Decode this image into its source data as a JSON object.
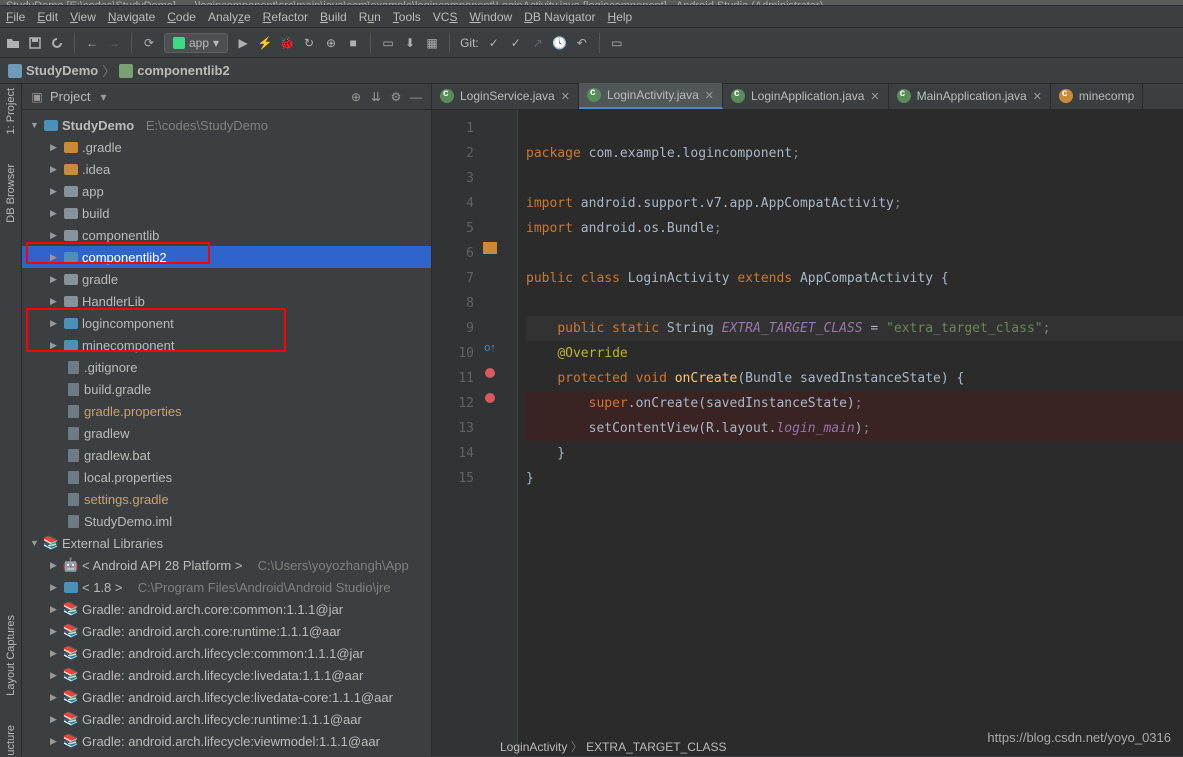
{
  "title": "StudyDemo [E:\\codes\\StudyDemo] - ...\\logincomponent\\src\\main\\java\\com\\example\\logincomponent\\LoginActivity.java [logincomponent] - Android Studio (Administrator)",
  "menu": [
    "File",
    "Edit",
    "View",
    "Navigate",
    "Code",
    "Analyze",
    "Refactor",
    "Build",
    "Run",
    "Tools",
    "VCS",
    "Window",
    "DB Navigator",
    "Help"
  ],
  "runConfig": "app",
  "gitLabel": "Git:",
  "breadcrumb": {
    "root": "StudyDemo",
    "item": "componentlib2"
  },
  "panel": {
    "title": "Project"
  },
  "leftStripe": [
    "1: Project",
    "DB Browser",
    "Layout Captures",
    "ucture"
  ],
  "tree": {
    "root": "StudyDemo",
    "rootPath": "E:\\codes\\StudyDemo",
    "items": [
      ".gradle",
      ".idea",
      "app",
      "build",
      "componentlib",
      "componentlib2",
      "gradle",
      "HandlerLib",
      "logincomponent",
      "minecomponent",
      ".gitignore",
      "build.gradle",
      "gradle.properties",
      "gradlew",
      "gradlew.bat",
      "local.properties",
      "settings.gradle",
      "StudyDemo.iml"
    ],
    "extlib": "External Libraries",
    "ext": {
      "androidSdk": "< Android API 28 Platform >",
      "androidSdkPath": "C:\\Users\\yoyozhangh\\App",
      "jdk": "< 1.8 >",
      "jdkPath": "C:\\Program Files\\Android\\Android Studio\\jre",
      "libs": [
        "Gradle: android.arch.core:common:1.1.1@jar",
        "Gradle: android.arch.core:runtime:1.1.1@aar",
        "Gradle: android.arch.lifecycle:common:1.1.1@jar",
        "Gradle: android.arch.lifecycle:livedata:1.1.1@aar",
        "Gradle: android.arch.lifecycle:livedata-core:1.1.1@aar",
        "Gradle: android.arch.lifecycle:runtime:1.1.1@aar",
        "Gradle: android.arch.lifecycle:viewmodel:1.1.1@aar"
      ]
    }
  },
  "tabs": [
    {
      "label": "LoginService.java",
      "active": false
    },
    {
      "label": "LoginActivity.java",
      "active": true
    },
    {
      "label": "LoginApplication.java",
      "active": false
    },
    {
      "label": "MainApplication.java",
      "active": false
    },
    {
      "label": "minecomp",
      "active": false
    }
  ],
  "code": {
    "lines": [
      "1",
      "2",
      "3",
      "4",
      "5",
      "6",
      "7",
      "8",
      "9",
      "10",
      "11",
      "12",
      "13",
      "14",
      "15"
    ],
    "l1_kw": "package",
    "l1_pkg": " com.example.logincomponent",
    "l3_kw": "import",
    "l3_pkg": " android.support.v7.app.AppCompatActivity",
    "l4_kw": "import",
    "l4_pkg": " android.os.Bundle",
    "l6_kw1": "public ",
    "l6_kw2": "class ",
    "l6_cls": "LoginActivity ",
    "l6_kw3": "extends ",
    "l6_sup": "AppCompatActivity ",
    "l8_kw1": "public ",
    "l8_kw2": "static ",
    "l8_type": "String ",
    "l8_var": "EXTRA_TARGET_CLASS",
    "l8_eq": " = ",
    "l8_str": "\"extra_target_class\"",
    "l9_ann": "@Override",
    "l10_kw1": "protected ",
    "l10_kw2": "void ",
    "l10_fn": "onCreate",
    "l10_sig": "(Bundle savedInstanceState) {",
    "l11_kw": "super",
    "l11_rest": ".onCreate(savedInstanceState)",
    "l12_fn": "setContentView",
    "l12_arg1": "(R.layout.",
    "l12_arg2": "login_main",
    "l12_arg3": ")"
  },
  "statusCrumb": {
    "a": "LoginActivity",
    "b": "EXTRA_TARGET_CLASS"
  },
  "watermark": "https://blog.csdn.net/yoyo_0316"
}
